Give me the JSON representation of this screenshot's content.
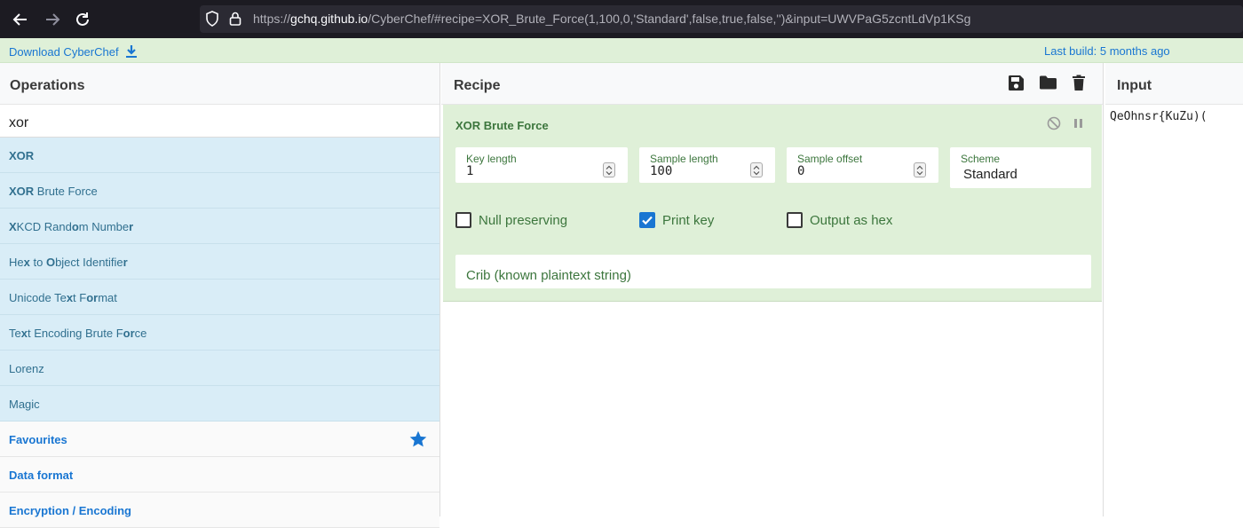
{
  "browser": {
    "url_prefix": "https://",
    "url_host": "gchq.github.io",
    "url_rest": "/CyberChef/#recipe=XOR_Brute_Force(1,100,0,'Standard',false,true,false,'')&input=UWVPaG5zcntLdVp1KSg"
  },
  "banner": {
    "download_label": "Download CyberChef",
    "build_label": "Last build: 5 months ago"
  },
  "operations": {
    "title": "Operations",
    "search_value": "xor",
    "results": [
      {
        "parts": [
          {
            "t": "XOR",
            "b": true
          }
        ]
      },
      {
        "parts": [
          {
            "t": "XOR",
            "b": true
          },
          {
            "t": " Brute Force",
            "b": false
          }
        ]
      },
      {
        "parts": [
          {
            "t": "X",
            "b": true
          },
          {
            "t": "KCD Rand",
            "b": false
          },
          {
            "t": "o",
            "b": true
          },
          {
            "t": "m Numbe",
            "b": false
          },
          {
            "t": "r",
            "b": true
          }
        ]
      },
      {
        "parts": [
          {
            "t": "He",
            "b": false
          },
          {
            "t": "x",
            "b": true
          },
          {
            "t": " to ",
            "b": false
          },
          {
            "t": "O",
            "b": true
          },
          {
            "t": "bject Identifie",
            "b": false
          },
          {
            "t": "r",
            "b": true
          }
        ]
      },
      {
        "parts": [
          {
            "t": "Unicode Te",
            "b": false
          },
          {
            "t": "x",
            "b": true
          },
          {
            "t": "t F",
            "b": false
          },
          {
            "t": "or",
            "b": true
          },
          {
            "t": "mat",
            "b": false
          }
        ]
      },
      {
        "parts": [
          {
            "t": "Te",
            "b": false
          },
          {
            "t": "x",
            "b": true
          },
          {
            "t": "t Encoding Brute F",
            "b": false
          },
          {
            "t": "or",
            "b": true
          },
          {
            "t": "ce",
            "b": false
          }
        ]
      },
      {
        "parts": [
          {
            "t": "Lorenz",
            "b": false
          }
        ]
      },
      {
        "parts": [
          {
            "t": "Magic",
            "b": false
          }
        ]
      }
    ],
    "categories": [
      "Favourites",
      "Data format",
      "Encryption / Encoding"
    ]
  },
  "recipe": {
    "title": "Recipe",
    "operation": {
      "name": "XOR Brute Force",
      "key_length": {
        "label": "Key length",
        "value": "1"
      },
      "sample_length": {
        "label": "Sample length",
        "value": "100"
      },
      "sample_offset": {
        "label": "Sample offset",
        "value": "0"
      },
      "scheme": {
        "label": "Scheme",
        "value": "Standard"
      },
      "null_preserving": {
        "label": "Null preserving",
        "checked": false
      },
      "print_key": {
        "label": "Print key",
        "checked": true
      },
      "output_as_hex": {
        "label": "Output as hex",
        "checked": false
      },
      "crib_placeholder": "Crib (known plaintext string)"
    }
  },
  "input": {
    "title": "Input",
    "value": "QeOhnsr{KuZu)("
  },
  "colors": {
    "accent": "#1976d2",
    "op_result_bg": "#d9edf7",
    "op_card_bg": "#dff0d8",
    "op_text": "#3c763d"
  }
}
